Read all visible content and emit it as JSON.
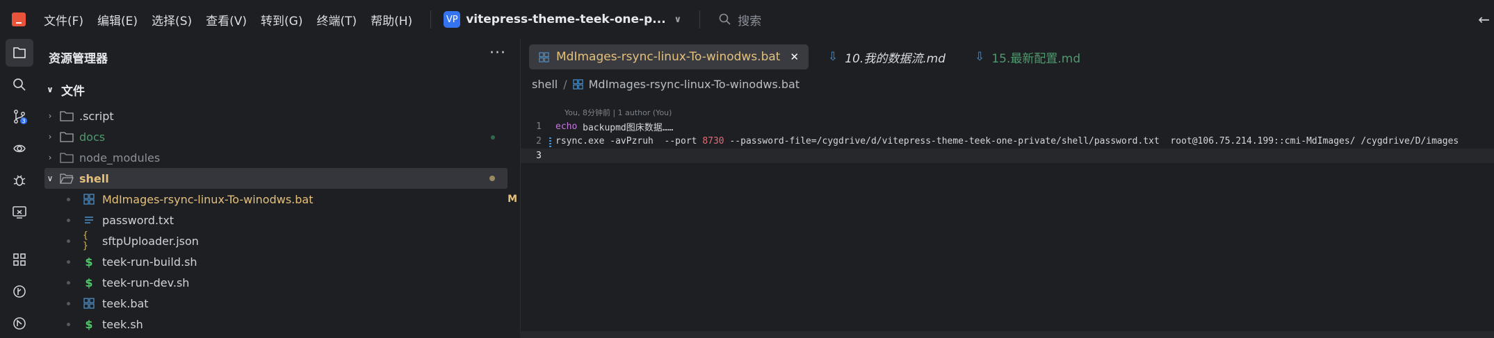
{
  "titlebar": {
    "menus": [
      {
        "label": "文件(F)"
      },
      {
        "label": "编辑(E)"
      },
      {
        "label": "选择(S)"
      },
      {
        "label": "查看(V)"
      },
      {
        "label": "转到(G)"
      },
      {
        "label": "终端(T)"
      },
      {
        "label": "帮助(H)"
      }
    ],
    "project_badge": "VP",
    "project_name": "vitepress-theme-teek-one-p...",
    "search_placeholder": "搜索"
  },
  "sidebar": {
    "title": "资源管理器",
    "more": "···",
    "root_label": "文件",
    "items": [
      {
        "label": ".script",
        "type": "folder",
        "color": "#cfd3da"
      },
      {
        "label": "docs",
        "type": "folder",
        "color": "#4e9a6f"
      },
      {
        "label": "node_modules",
        "type": "folder",
        "color": "#8b9099"
      },
      {
        "label": "shell",
        "type": "folder",
        "color": "#e5c07b"
      },
      {
        "label": "MdImages-rsync-linux-To-winodws.bat",
        "type": "bat",
        "color": "#e5c07b",
        "badge": "M"
      },
      {
        "label": "password.txt",
        "type": "txt",
        "color": "#cfd3da"
      },
      {
        "label": "sftpUploader.json",
        "type": "json",
        "color": "#cfd3da"
      },
      {
        "label": "teek-run-build.sh",
        "type": "sh",
        "color": "#cfd3da"
      },
      {
        "label": "teek-run-dev.sh",
        "type": "sh",
        "color": "#cfd3da"
      },
      {
        "label": "teek.bat",
        "type": "bat",
        "color": "#cfd3da"
      },
      {
        "label": "teek.sh",
        "type": "sh",
        "color": "#cfd3da"
      }
    ]
  },
  "editor": {
    "tabs": [
      {
        "label": "MdImages-rsync-linux-To-winodws.bat",
        "close": "✕"
      },
      {
        "label": "10.我的数据流.md"
      },
      {
        "label": "15.最新配置.md"
      }
    ],
    "breadcrumb": {
      "folder": "shell",
      "file": "MdImages-rsync-linux-To-winodws.bat"
    },
    "blame": "You, 8分钟前 | 1 author (You)",
    "lines": [
      {
        "n": "1",
        "kw": "echo",
        "rest": " backupmd图床数据……"
      },
      {
        "n": "2",
        "pre": "rsync.exe -avPzruh  --port ",
        "num": "8730",
        "rest": " --password-file=/cygdrive/d/vitepress-theme-teek-one-private/shell/password.txt  root@106.75.214.199::cmi-MdImages/ /cygdrive/D/images"
      },
      {
        "n": "3"
      }
    ]
  },
  "icons": {
    "activity": [
      "files-icon",
      "search-icon",
      "source-control-icon",
      "remote-icon",
      "debug-icon",
      "remote-explorer-icon",
      "extensions-icon",
      "timeline-icon",
      "gitlens-icon"
    ]
  },
  "colors": {
    "accent": "#3574f0",
    "modified": "#e5c07b",
    "added": "#4e9a6f"
  }
}
